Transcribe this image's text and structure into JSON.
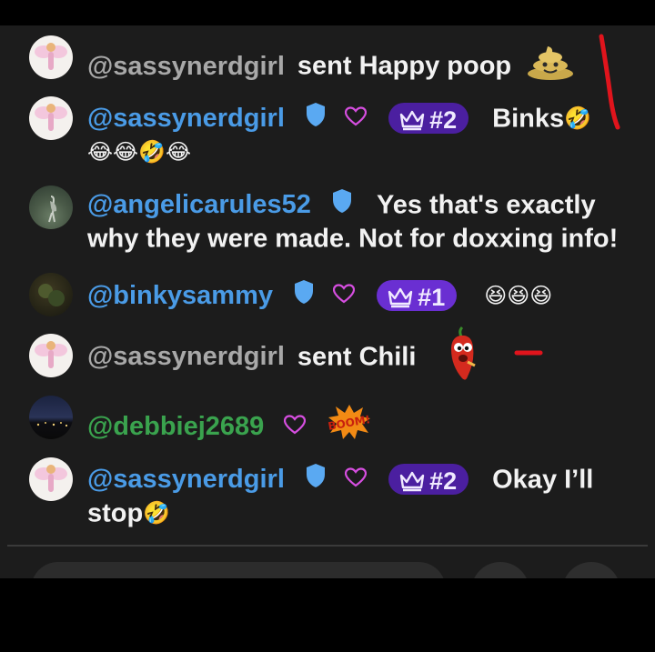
{
  "messages": [
    {
      "user": "@sassynerdgirl",
      "text": "sent Happy poop",
      "emoji": "💩"
    },
    {
      "user": "@sassynerdgirl",
      "badge": "#2",
      "text": "Binks",
      "emoji": "🤣",
      "cont": "😂😂🤣😂"
    },
    {
      "user": "@angelicarules52",
      "text": "Yes that's exactly",
      "cont": "why they were made. Not for doxxing info!"
    },
    {
      "user": "@binkysammy",
      "badge": "#1",
      "emoji": "😆😆😆"
    },
    {
      "user": "@sassynerdgirl",
      "text": "sent Chili"
    },
    {
      "user": "@debbiej2689",
      "sticker": "BOOM!"
    },
    {
      "user": "@sassynerdgirl",
      "badge": "#2",
      "text": "Okay I’ll",
      "cont": "stop",
      "emoji": "🤣"
    }
  ],
  "colors": {
    "username_gray": "#a8a8a8",
    "username_blue": "#4a9be6",
    "username_green": "#3aa34e",
    "badge_bg": "#4b1fa0",
    "shield": "#5aa9f2",
    "heart": "#d64ee0",
    "annotation": "#e0141c"
  },
  "icons": {
    "verified": "shield-icon",
    "follow": "heart-outline-icon",
    "rank": "crown-icon",
    "poop": "poop-emoji-icon",
    "chili": "chili-pepper-sticker",
    "boom": "boom-sticker"
  }
}
